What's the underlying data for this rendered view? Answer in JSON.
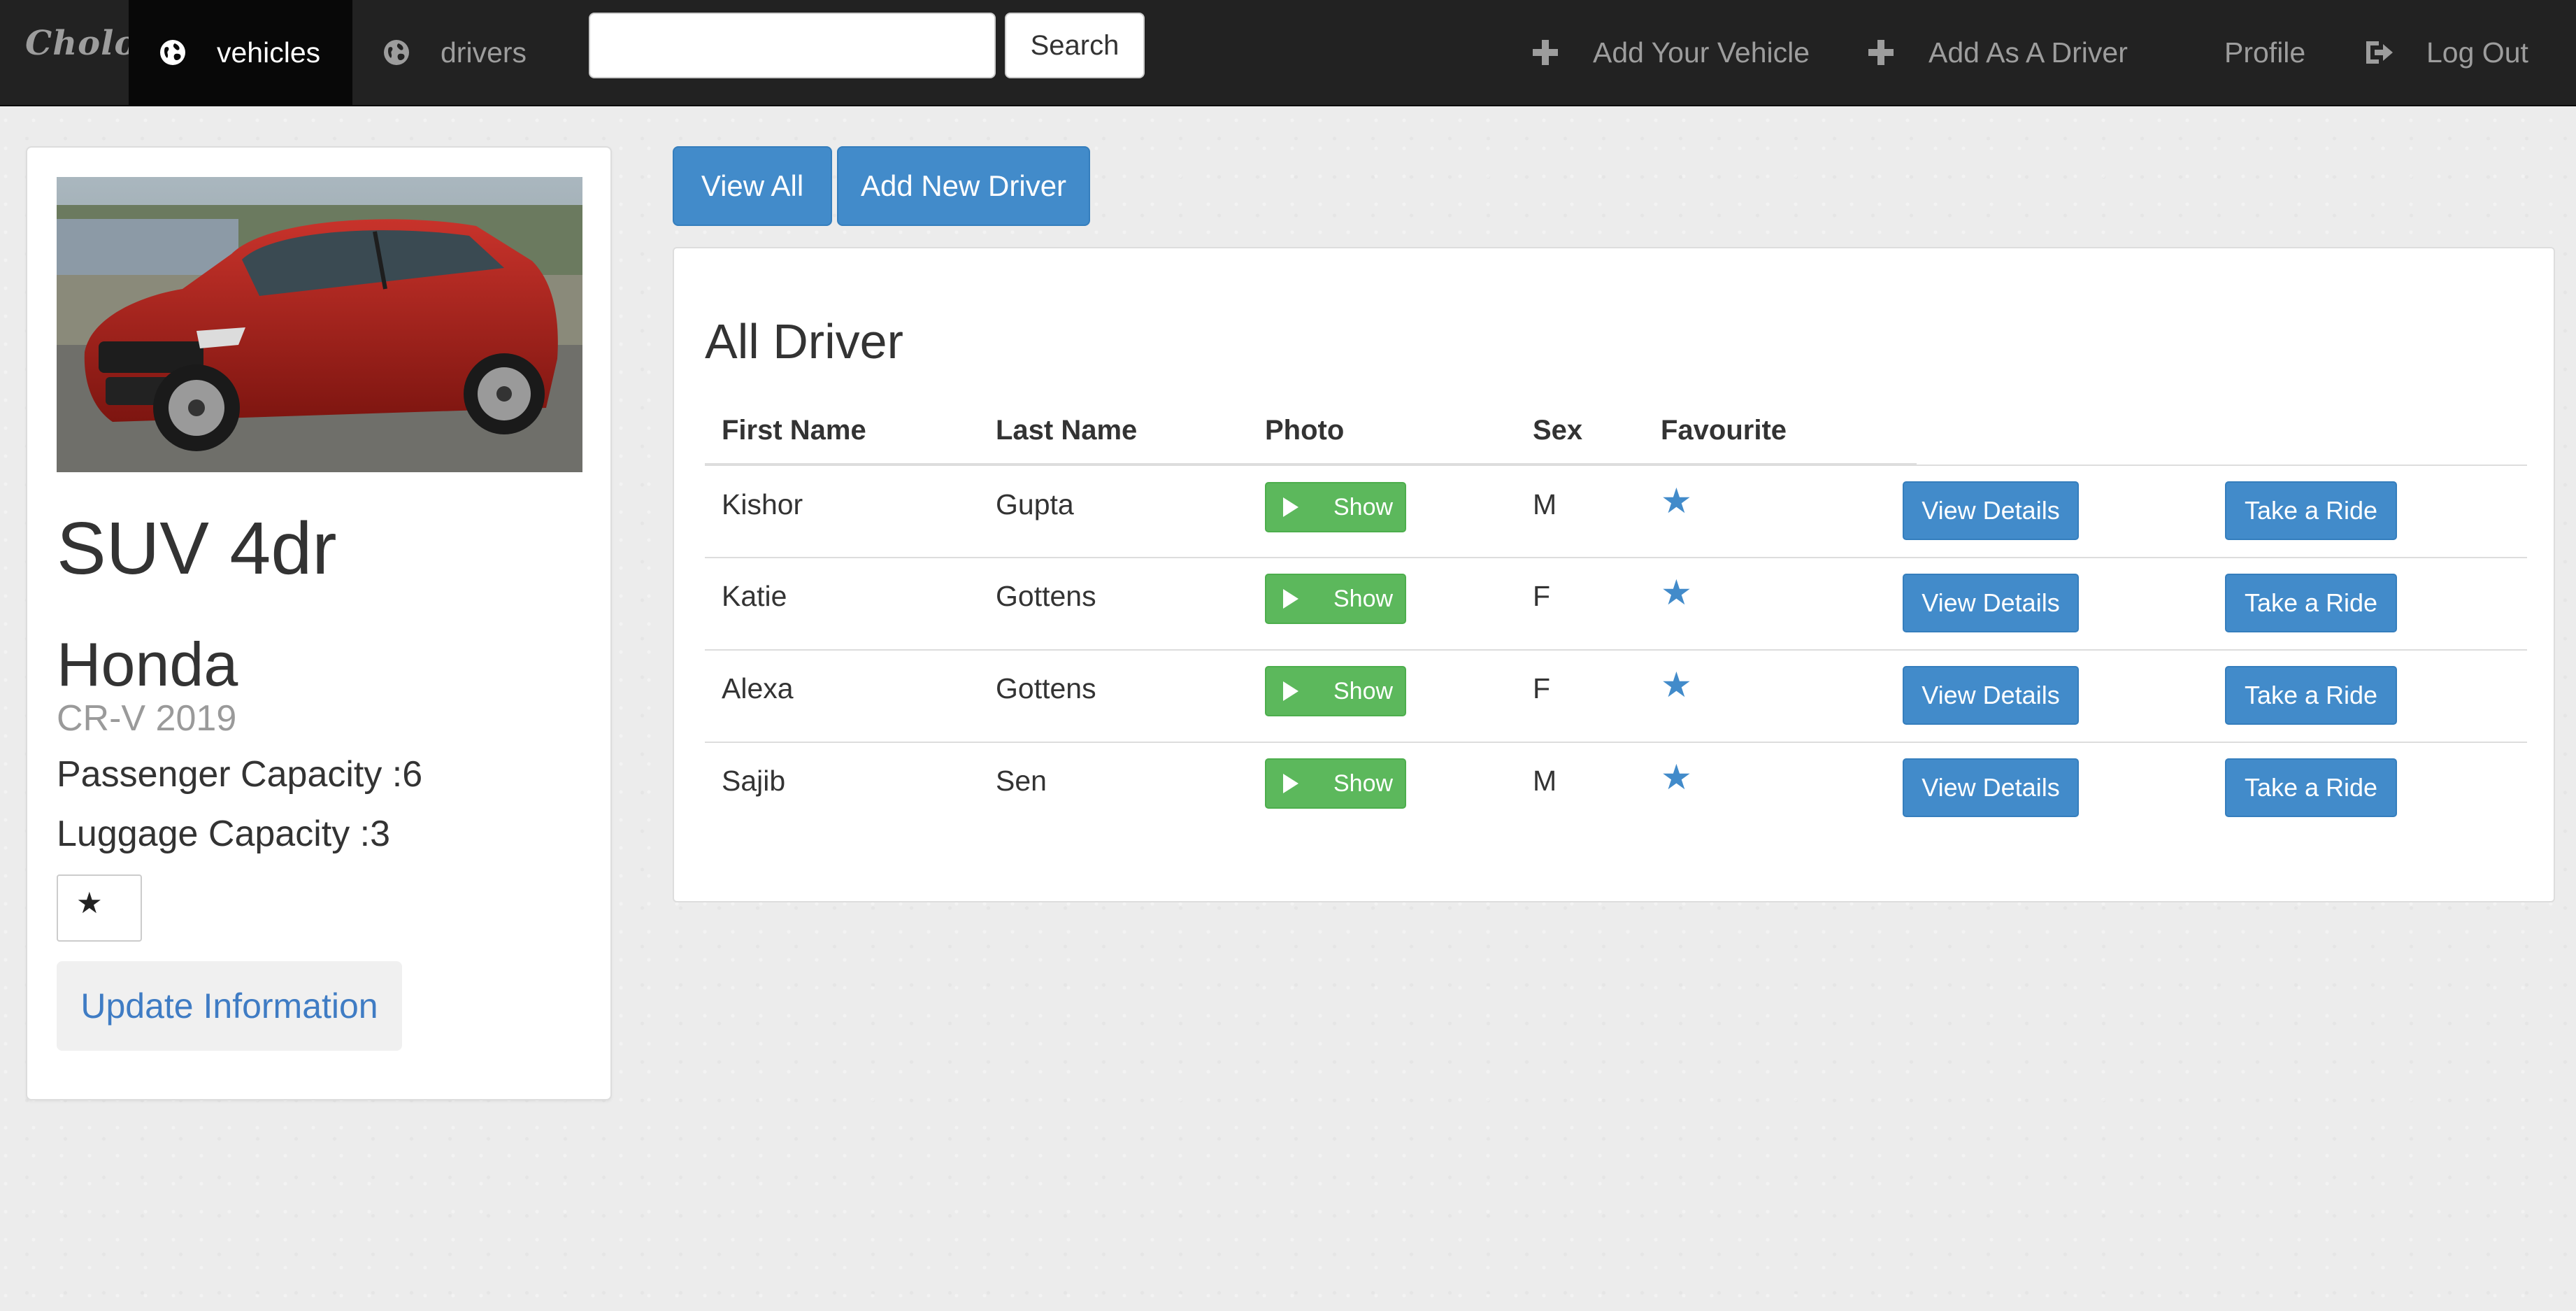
{
  "navbar": {
    "brand": "Cholo",
    "tabs": [
      {
        "label": "vehicles",
        "active": true
      },
      {
        "label": "drivers",
        "active": false
      }
    ],
    "search": {
      "placeholder": "",
      "value": "",
      "button_label": "Search"
    },
    "right_items": [
      {
        "label": "Add Your Vehicle",
        "icon": "plus-icon"
      },
      {
        "label": "Add As A Driver",
        "icon": "plus-icon"
      },
      {
        "label": "Profile"
      },
      {
        "label": "Log Out",
        "icon": "log-out-icon"
      }
    ]
  },
  "vehicle": {
    "type": "SUV 4dr",
    "make": "Honda",
    "model": "CR-V 2019",
    "passenger_capacity": "Passenger Capacity :6",
    "luggage_capacity": "Luggage Capacity :3",
    "favourite_star": "★",
    "update_label": "Update Information",
    "photo_icon": "car-photo"
  },
  "actions": {
    "view_all": "View All",
    "add_new_driver": "Add New Driver"
  },
  "drivers_panel": {
    "title": "All Driver",
    "columns": [
      "First Name",
      "Last Name",
      "Photo",
      "Sex",
      "Favourite"
    ],
    "rows": [
      {
        "first": "Kishor",
        "last": "Gupta",
        "photo_btn": "Show",
        "sex": "M",
        "fav": "★",
        "details": "View Details",
        "ride": "Take a Ride"
      },
      {
        "first": "Katie",
        "last": "Gottens",
        "photo_btn": "Show",
        "sex": "F",
        "fav": "★",
        "details": "View Details",
        "ride": "Take a Ride"
      },
      {
        "first": "Alexa",
        "last": "Gottens",
        "photo_btn": "Show",
        "sex": "F",
        "fav": "★",
        "details": "View Details",
        "ride": "Take a Ride"
      },
      {
        "first": "Sajib",
        "last": "Sen",
        "photo_btn": "Show",
        "sex": "M",
        "fav": "★",
        "details": "View Details",
        "ride": "Take a Ride"
      }
    ]
  },
  "colors": {
    "navbar_bg": "#222222",
    "active_tab_bg": "#080808",
    "primary": "#428bca",
    "success": "#5cb85c",
    "link": "#3f7cc4"
  }
}
